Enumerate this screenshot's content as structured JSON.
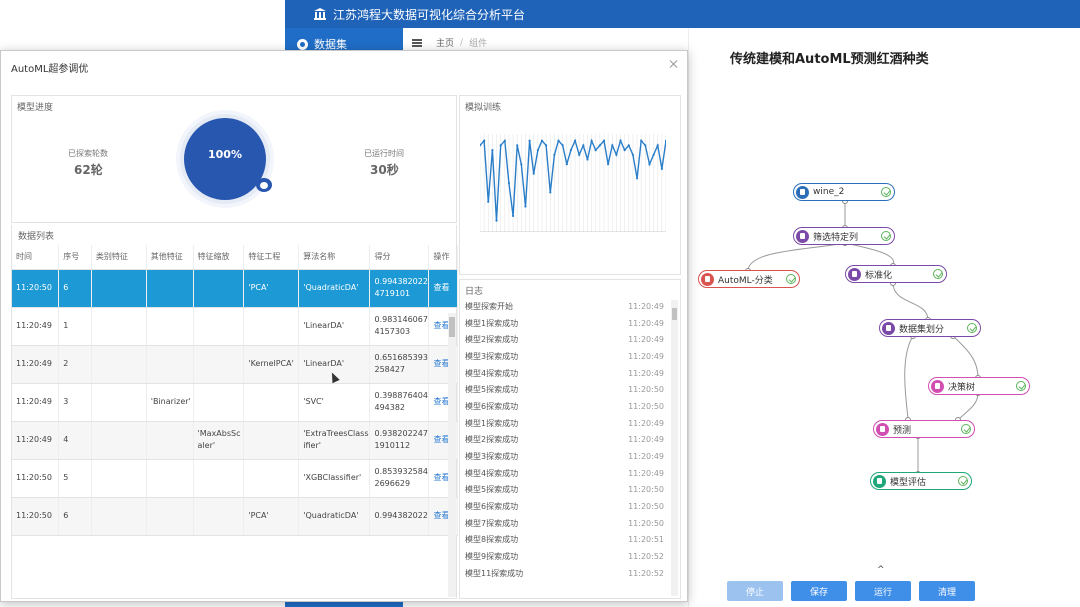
{
  "app": {
    "title": "江苏鸿程大数据可视化综合分析平台",
    "sidebar_item": "数据集",
    "breadcrumb": [
      "主页",
      "组件"
    ]
  },
  "canvas": {
    "title": "传统建模和AutoML预测红酒种类",
    "nodes": [
      {
        "id": "wine",
        "label": "wine_2",
        "color": "#2c6fb8"
      },
      {
        "id": "filter",
        "label": "筛选特定列",
        "color": "#7b4aa8"
      },
      {
        "id": "automl",
        "label": "AutoML-分类",
        "color": "#d9534f"
      },
      {
        "id": "std",
        "label": "标准化",
        "color": "#7b4aa8"
      },
      {
        "id": "split",
        "label": "数据集划分",
        "color": "#7b4aa8"
      },
      {
        "id": "tree",
        "label": "决策树",
        "color": "#d04fb0"
      },
      {
        "id": "predict",
        "label": "预测",
        "color": "#d04fb0"
      },
      {
        "id": "eval",
        "label": "模型评估",
        "color": "#1fa77a"
      }
    ],
    "toggle": "^",
    "buttons": [
      {
        "label": "停止",
        "disabled": true
      },
      {
        "label": "保存",
        "disabled": false
      },
      {
        "label": "运行",
        "disabled": false
      },
      {
        "label": "清理",
        "disabled": false
      }
    ]
  },
  "modal": {
    "title": "AutoML超参调优",
    "progress": {
      "panel_title": "模型进度",
      "explored_label": "已探索轮数",
      "explored_value": "62轮",
      "percent_text": "100%",
      "percent": 100,
      "runtime_label": "已运行时间",
      "runtime_value": "30秒"
    },
    "train": {
      "panel_title": "模拟训练",
      "series": [
        0.1,
        0.05,
        0.7,
        0.15,
        0.9,
        0.1,
        0.05,
        0.5,
        0.85,
        0.1,
        0.3,
        0.75,
        0.05,
        0.4,
        0.15,
        0.05,
        0.1,
        0.6,
        0.2,
        0.05,
        0.1,
        0.3,
        0.15,
        0.05,
        0.2,
        0.1,
        0.25,
        0.05,
        0.15,
        0.1,
        0.05,
        0.3,
        0.1,
        0.2,
        0.05,
        0.15,
        0.1,
        0.2,
        0.45,
        0.05,
        0.1,
        0.3,
        0.2,
        0.1,
        0.35,
        0.05
      ]
    },
    "log": {
      "panel_title": "日志",
      "rows": [
        {
          "msg": "模型探索开始",
          "time": "11:20:49"
        },
        {
          "msg": "模型1探索成功",
          "time": "11:20:49"
        },
        {
          "msg": "模型2探索成功",
          "time": "11:20:49"
        },
        {
          "msg": "模型3探索成功",
          "time": "11:20:49"
        },
        {
          "msg": "模型4探索成功",
          "time": "11:20:49"
        },
        {
          "msg": "模型5探索成功",
          "time": "11:20:50"
        },
        {
          "msg": "模型6探索成功",
          "time": "11:20:50"
        },
        {
          "msg": "模型1探索成功",
          "time": "11:20:49"
        },
        {
          "msg": "模型2探索成功",
          "time": "11:20:49"
        },
        {
          "msg": "模型3探索成功",
          "time": "11:20:49"
        },
        {
          "msg": "模型4探索成功",
          "time": "11:20:49"
        },
        {
          "msg": "模型5探索成功",
          "time": "11:20:50"
        },
        {
          "msg": "模型6探索成功",
          "time": "11:20:50"
        },
        {
          "msg": "模型7探索成功",
          "time": "11:20:50"
        },
        {
          "msg": "模型8探索成功",
          "time": "11:20:51"
        },
        {
          "msg": "模型9探索成功",
          "time": "11:20:52"
        },
        {
          "msg": "模型11探索成功",
          "time": "11:20:52"
        }
      ]
    },
    "table": {
      "panel_title": "数据列表",
      "headers": [
        "时间",
        "序号",
        "类别特征",
        "其他特征",
        "特征缩放",
        "特征工程",
        "算法名称",
        "得分",
        "操作"
      ],
      "rows": [
        [
          "11:20:50",
          "6",
          "",
          "",
          "",
          "'PCA'",
          "'QuadraticDA'",
          "0.9943820224719101",
          "查看"
        ],
        [
          "11:20:49",
          "1",
          "",
          "",
          "",
          "",
          "'LinearDA'",
          "0.9831460674157303",
          "查看"
        ],
        [
          "11:20:49",
          "2",
          "",
          "",
          "",
          "'KernelPCA'",
          "'LinearDA'",
          "0.651685393258427",
          "查看"
        ],
        [
          "11:20:49",
          "3",
          "",
          "'Binarizer'",
          "",
          "",
          "'SVC'",
          "0.398876404494382",
          "查看"
        ],
        [
          "11:20:49",
          "4",
          "",
          "",
          "'MaxAbsScaler'",
          "",
          "'ExtraTreesClassifier'",
          "0.9382022471910112",
          "查看"
        ],
        [
          "11:20:50",
          "5",
          "",
          "",
          "",
          "",
          "'XGBClassifier'",
          "0.8539325842696629",
          "查看"
        ],
        [
          "11:20:50",
          "6",
          "",
          "",
          "",
          "'PCA'",
          "'QuadraticDA'",
          "0.994382022",
          "查看"
        ]
      ]
    }
  }
}
